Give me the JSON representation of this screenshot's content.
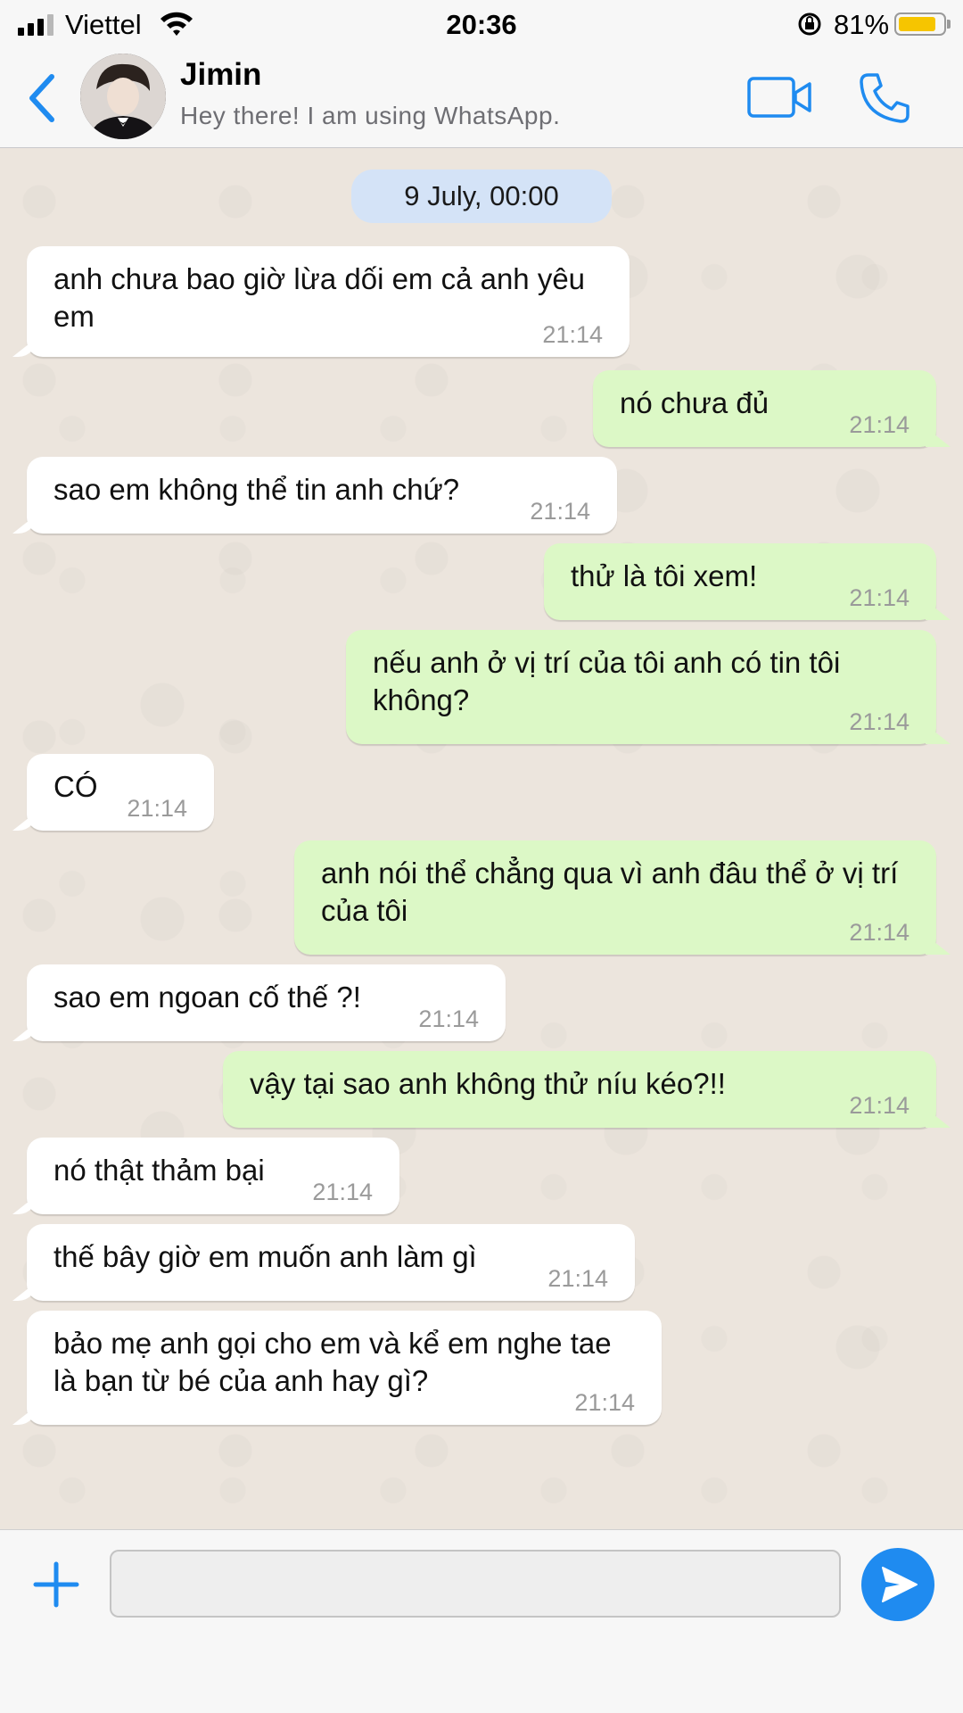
{
  "status_bar": {
    "carrier": "Viettel",
    "time": "20:36",
    "battery_percent": "81%",
    "battery_level": 0.81,
    "icons": [
      "signal-icon",
      "wifi-icon",
      "rotation-lock-icon",
      "battery-icon"
    ]
  },
  "header": {
    "back_icon": "chevron-left-icon",
    "contact_name": "Jimin",
    "contact_status": "Hey there! I am using WhatsApp.",
    "video_icon": "video-camera-icon",
    "call_icon": "phone-icon"
  },
  "chat": {
    "date_label": "9 July, 00:00",
    "messages": [
      {
        "direction": "in",
        "text": "anh chưa bao giờ lừa dối em cả anh yêu em",
        "time": "21:14"
      },
      {
        "direction": "out",
        "text": "nó chưa đủ",
        "time": "21:14"
      },
      {
        "direction": "in",
        "text": "sao em không thể tin anh chứ?",
        "time": "21:14"
      },
      {
        "direction": "out",
        "text": "thử là tôi xem!",
        "time": "21:14"
      },
      {
        "direction": "out",
        "text": "nếu anh ở vị trí của tôi anh có tin tôi không?",
        "time": "21:14"
      },
      {
        "direction": "in",
        "text": "CÓ",
        "time": "21:14"
      },
      {
        "direction": "out",
        "text": "anh nói thể chẳng qua vì anh đâu thể ở vị trí của tôi",
        "time": "21:14"
      },
      {
        "direction": "in",
        "text": "sao em ngoan cố thế ?!",
        "time": "21:14"
      },
      {
        "direction": "out",
        "text": "vậy tại sao anh không thử níu kéo?!!",
        "time": "21:14"
      },
      {
        "direction": "in",
        "text": "nó thật thảm bại",
        "time": "21:14"
      },
      {
        "direction": "in",
        "text": "thế bây giờ em muốn anh làm gì",
        "time": "21:14"
      },
      {
        "direction": "in",
        "text": "bảo mẹ anh gọi cho em và kể em nghe tae là bạn từ bé của anh hay gì?",
        "time": "21:14"
      }
    ]
  },
  "composer": {
    "input_value": "",
    "plus_icon": "plus-icon",
    "send_icon": "send-icon"
  },
  "colors": {
    "accent": "#1f8bf0",
    "incoming_bubble": "#ffffff",
    "outgoing_bubble": "#dcf8c6",
    "date_pill": "#d4e3f7",
    "chat_background": "#ece5dd"
  }
}
